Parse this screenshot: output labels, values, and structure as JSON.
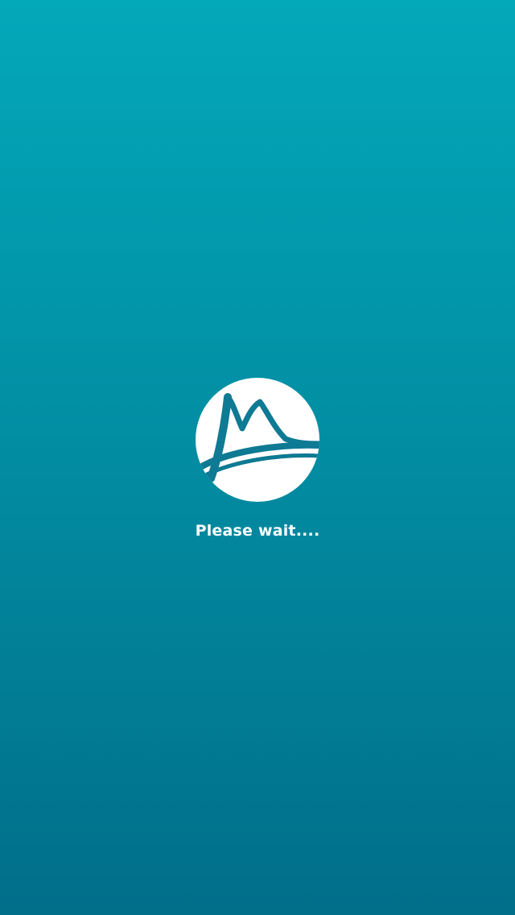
{
  "splash": {
    "logo_icon": "bridge-logo-icon",
    "status_text": "Please wait....",
    "colors": {
      "background_top": "#03a8b9",
      "background_bottom": "#016e8a",
      "logo_circle": "#ffffff",
      "logo_mark": "#0e7a93",
      "text": "#ffffff"
    }
  }
}
